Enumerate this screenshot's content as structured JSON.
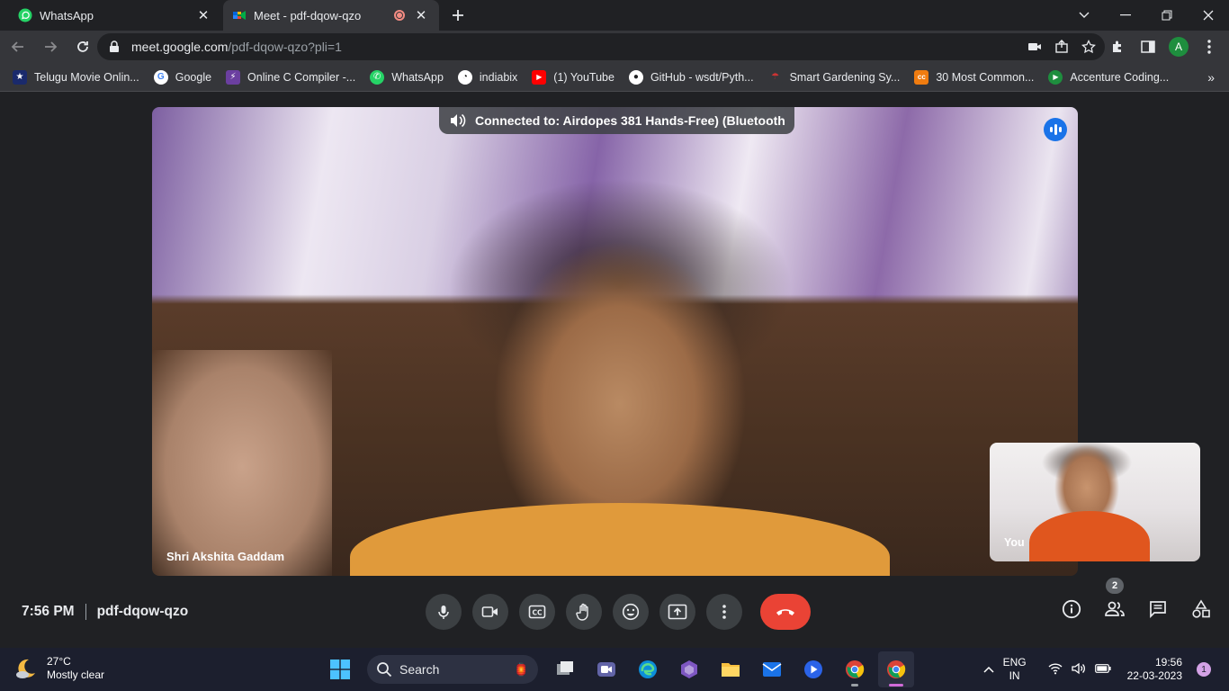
{
  "browser": {
    "tabs": [
      {
        "title": "WhatsApp",
        "favicon": "whatsapp-icon",
        "active": false
      },
      {
        "title": "Meet - pdf-dqow-qzo",
        "favicon": "google-meet-icon",
        "active": true,
        "recording": true
      }
    ],
    "url_host": "meet.google.com",
    "url_path": "/pdf-dqow-qzo?pli=1",
    "profile_initial": "A"
  },
  "bookmarks": [
    {
      "label": "Telugu Movie Onlin...",
      "icon": "movie-icon",
      "color": "#1a2a6c"
    },
    {
      "label": "Google",
      "icon": "google-icon",
      "color": "#ffffff"
    },
    {
      "label": "Online C Compiler -...",
      "icon": "bolt-icon",
      "color": "#6b3fa0"
    },
    {
      "label": "WhatsApp",
      "icon": "whatsapp-icon",
      "color": "#25d366"
    },
    {
      "label": "indiabix",
      "icon": "indiabix-icon",
      "color": "#ffffff"
    },
    {
      "label": "(1) YouTube",
      "icon": "youtube-icon",
      "color": "#ff0000"
    },
    {
      "label": "GitHub - wsdt/Pyth...",
      "icon": "github-icon",
      "color": "#ffffff"
    },
    {
      "label": "Smart Gardening Sy...",
      "icon": "garden-icon",
      "color": "#cc3333"
    },
    {
      "label": "30 Most Common...",
      "icon": "cc-icon",
      "color": "#f07c10"
    },
    {
      "label": "Accenture Coding...",
      "icon": "play-icon",
      "color": "#1e8e3e"
    }
  ],
  "meet": {
    "connection": "Connected to: Airdopes 381 Hands-Free) (Bluetooth",
    "main_participant": "Shri Akshita Gaddam",
    "self_label": "You",
    "time": "7:56 PM",
    "meeting_code": "pdf-dqow-qzo",
    "participant_count": "2"
  },
  "taskbar": {
    "temperature": "27°C",
    "weather": "Mostly clear",
    "search_label": "Search",
    "lang_top": "ENG",
    "lang_bottom": "IN",
    "time": "19:56",
    "date": "22-03-2023",
    "notifications": "1"
  }
}
